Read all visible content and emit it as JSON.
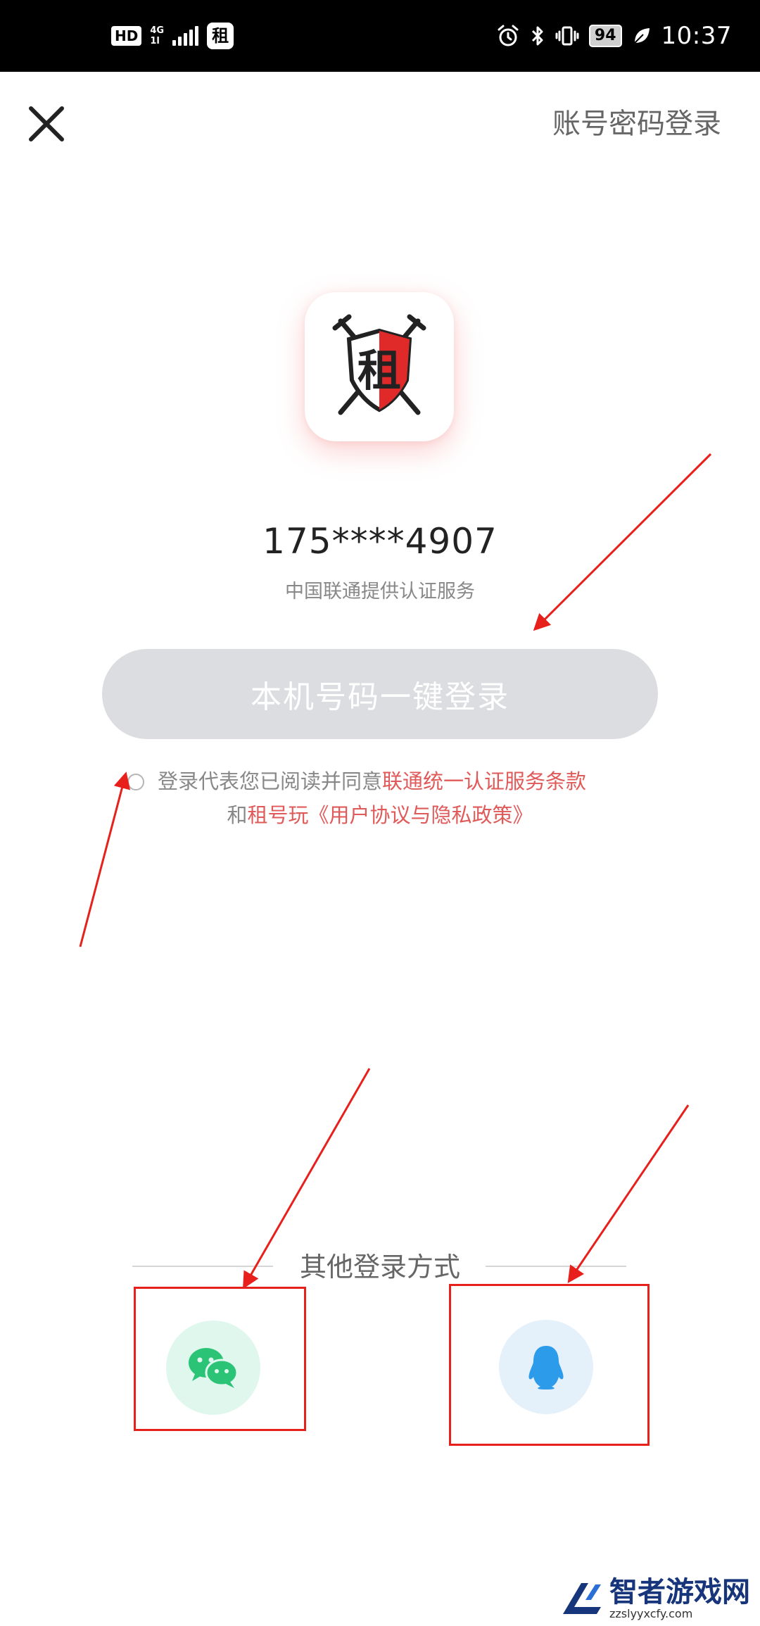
{
  "status_bar": {
    "hd": "HD",
    "network_top": "4G",
    "network_bottom": "1l",
    "battery": "94",
    "time": "10:37"
  },
  "header": {
    "password_login": "账号密码登录"
  },
  "logo": {
    "glyph": "租"
  },
  "account": {
    "phone": "175****4907",
    "provider": "中国联通提供认证服务"
  },
  "login": {
    "one_tap_label": "本机号码一键登录"
  },
  "agreement": {
    "prefix": "登录代表您已阅读并同意",
    "carrier_terms": "联通统一认证服务条款",
    "and": "和",
    "app_name": "租号玩",
    "policy": "《用户协议与隐私政策》"
  },
  "other": {
    "label": "其他登录方式"
  },
  "watermark": {
    "title": "智者游戏网",
    "url": "zzslyyxcfy.com"
  },
  "colors": {
    "link": "#e05a5a",
    "button_disabled": "#dcdde1",
    "wechat": "#2bc477",
    "qq": "#2b9bea",
    "annotation": "#e8201c"
  }
}
